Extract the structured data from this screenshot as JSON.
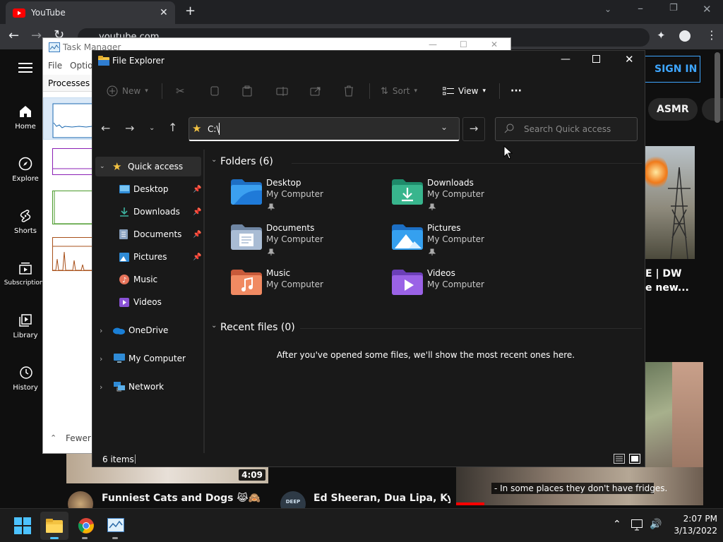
{
  "chrome": {
    "tab_title": "YouTube",
    "url": "youtube.com"
  },
  "youtube": {
    "sign_in": "SIGN IN",
    "nav": [
      {
        "label": "Home"
      },
      {
        "label": "Explore"
      },
      {
        "label": "Shorts"
      },
      {
        "label": "Subscriptions"
      },
      {
        "label": "Library"
      },
      {
        "label": "History"
      }
    ],
    "chips": [
      "ASMR"
    ],
    "right_video_title_line1": "E | DW",
    "right_video_title_line2": "e new...",
    "video1_duration": "4:09",
    "video1_title": "Funniest Cats and Dogs 😹🙈",
    "video2_title": "Ed Sheeran, Dua Lipa, Kygo, Av",
    "video2_avatar_text": "DEEP",
    "caption": "- In some places they don't have fridges."
  },
  "task_manager": {
    "title": "Task Manager",
    "menu": [
      "File",
      "Optio"
    ],
    "tab": "Processes",
    "fewer_details": "Fewer"
  },
  "file_explorer": {
    "title": "File Explorer",
    "toolbar": {
      "new": "New",
      "sort": "Sort",
      "view": "View",
      "more": "···"
    },
    "address": "C:\\",
    "search_placeholder": "Search Quick access",
    "nav": {
      "quick_access": "Quick access",
      "pinned": [
        "Desktop",
        "Downloads",
        "Documents",
        "Pictures"
      ],
      "unpinned": [
        "Music",
        "Videos"
      ],
      "onedrive": "OneDrive",
      "my_computer": "My Computer",
      "network": "Network"
    },
    "folders_header": "Folders (6)",
    "folders": [
      {
        "name": "Desktop",
        "location": "My Computer"
      },
      {
        "name": "Downloads",
        "location": "My Computer"
      },
      {
        "name": "Documents",
        "location": "My Computer"
      },
      {
        "name": "Pictures",
        "location": "My Computer"
      },
      {
        "name": "Music",
        "location": "My Computer"
      },
      {
        "name": "Videos",
        "location": "My Computer"
      }
    ],
    "recent_header": "Recent files (0)",
    "recent_empty": "After you've opened some files, we'll show the most recent ones here.",
    "status_items": "6 items"
  },
  "taskbar": {
    "time": "2:07 PM",
    "date": "3/13/2022"
  },
  "colors": {
    "accent_blue": "#3ea6ff",
    "folder_yellow": "#f4c342",
    "window_bg": "#191919"
  }
}
